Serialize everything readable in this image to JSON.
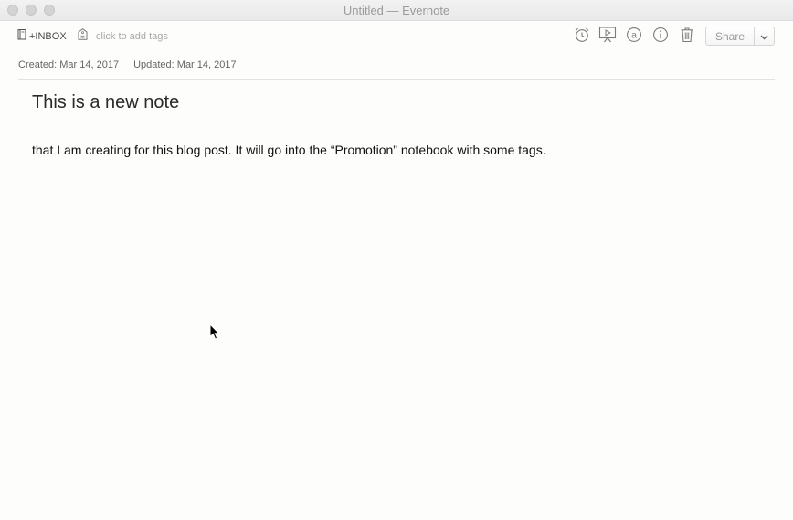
{
  "window": {
    "title": "Untitled — Evernote"
  },
  "toolbar": {
    "notebook_label": "+INBOX",
    "tags_placeholder": "click to add tags",
    "icons": [
      "notebook-icon",
      "tag-icon",
      "alarm-icon",
      "presentation-icon",
      "at-icon",
      "info-icon",
      "trash-icon",
      "chevron-down-icon"
    ],
    "share_label": "Share"
  },
  "meta": {
    "created": "Created: Mar 14, 2017",
    "updated": "Updated: Mar 14, 2017"
  },
  "note": {
    "title": "This is a new note",
    "body": "that I am creating for this blog post. It will go into the “Promotion” notebook with some tags."
  },
  "colors": {
    "background": "#fdfdfc",
    "titlebar": "#ececec",
    "icon": "#7a7a7a",
    "text": "#111111"
  }
}
